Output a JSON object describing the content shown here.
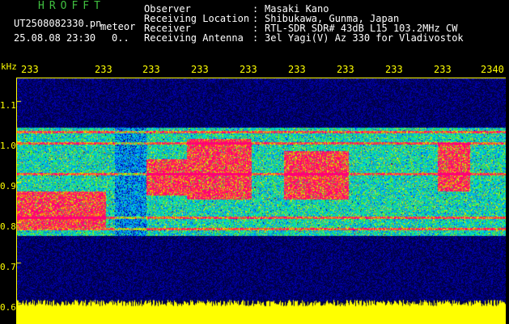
{
  "header": {
    "brand": "HROFFT",
    "file": "UT2508082330.pn",
    "subtitle": "meteor",
    "datetime": "25.08.08 23:30",
    "count": "0..",
    "fields": [
      {
        "label": "Observer",
        "value": "Masaki Kano"
      },
      {
        "label": "Receiving Location",
        "value": "Shibukawa, Gunma, Japan"
      },
      {
        "label": "Receiver",
        "value": "RTL-SDR SDR# 43dB L15 103.2MHz CW"
      },
      {
        "label": "Receiving Antenna",
        "value": "3el Yagi(V) Az 330 for Vladivostok"
      }
    ]
  },
  "axis": {
    "y_unit": "kHz",
    "y_ticks": [
      "1.1",
      "1.0",
      "0.9",
      "0.8",
      "0.7",
      "0.6"
    ],
    "x_ticks": [
      "233",
      "233",
      "233",
      "233",
      "233",
      "233",
      "233",
      "233",
      "233",
      "2340"
    ]
  },
  "colors": {
    "background": "#000000",
    "axis": "#ffff00",
    "brand": "#40c040",
    "text": "#ffffff"
  }
}
